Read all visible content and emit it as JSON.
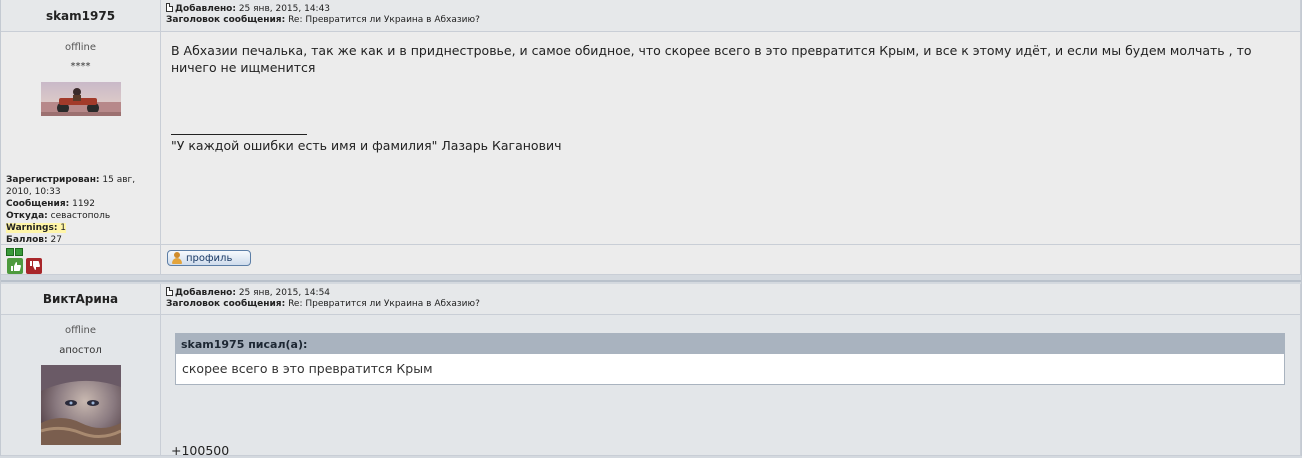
{
  "posts": [
    {
      "author": "skam1975",
      "added_label": "Добавлено:",
      "added_value": "25 янв, 2015, 14:43",
      "subject_label": "Заголовок сообщения:",
      "subject_value": "Re: Превратится ли Украина в Абхазию?",
      "status": "offline",
      "rank": "****",
      "registered_label": "Зарегистрирован:",
      "registered_value": "15 авг, 2010, 10:33",
      "messages_label": "Сообщения:",
      "messages_value": "1192",
      "from_label": "Откуда:",
      "from_value": "севастополь",
      "warnings_label": "Warnings:",
      "warnings_value": "1",
      "points_label": "Баллов:",
      "points_value": "27",
      "body": "В Абхазии печалька, так же как и в приднестровье, и самое обидное, что скорее всего в это превратится Крым, и все к этому идёт, и если мы будем молчать , то ничего не ищменится",
      "signature": "\"У каждой ошибки есть имя и фамилия\" Лазарь Каганович",
      "profile_button": "профиль"
    },
    {
      "author": "ВиктАрина",
      "added_label": "Добавлено:",
      "added_value": "25 янв, 2015, 14:54",
      "subject_label": "Заголовок сообщения:",
      "subject_value": "Re: Превратится ли Украина в Абхазию?",
      "status": "offline",
      "rank": "апостол",
      "quote_header": "skam1975 писал(а):",
      "quote_body": "скорее всего в это превратится Крым",
      "body": "+100500"
    }
  ],
  "colors": {
    "quote_header_bg": "#a9b3bf",
    "warnings_highlight": "#fff5a8"
  }
}
